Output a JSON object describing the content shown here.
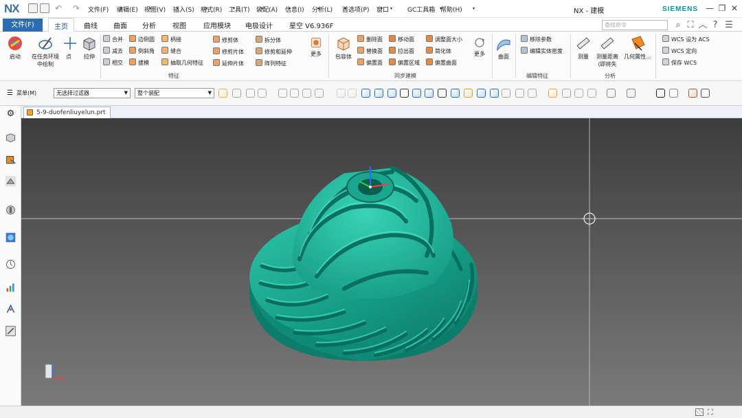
{
  "app": {
    "logo": "NX",
    "window_title": "NX - 建模",
    "brand": "SIEMENS"
  },
  "menubar": {
    "items": [
      "文件(F)",
      "编辑(E)",
      "视图(V)",
      "插入(S)",
      "格式(R)",
      "工具(T)",
      "装配(A)",
      "信息(I)",
      "分析(L)",
      "首选项(P)",
      "窗口",
      "GC工具箱",
      "帮助(H)"
    ]
  },
  "ribbon_tabs": {
    "file": "文件(F)",
    "tabs": [
      "主页",
      "曲线",
      "曲面",
      "分析",
      "视图",
      "应用模块",
      "电极设计",
      "星空 V6.936F"
    ],
    "active": "主页"
  },
  "search": {
    "placeholder": "查找命令"
  },
  "ribbon": {
    "sketch": {
      "label": "启动",
      "direct_sketch": "在任务环境中绘制",
      "point": "点",
      "extrude": "拉伸"
    },
    "feature": {
      "label": "特征",
      "col1": [
        "合并",
        "减去",
        "相交"
      ],
      "col2": [
        "边倒圆",
        "倒斜角",
        "拔模"
      ],
      "col3": [
        "柄接",
        "缝合",
        "抽取几何特征"
      ],
      "trim_col1": [
        "修剪体",
        "修剪片体",
        "延伸片体"
      ],
      "trim_col2": [
        "拆分体",
        "修剪和延伸",
        "阵列特征"
      ],
      "more": "更多"
    },
    "sync": {
      "label": "同步建模",
      "package": "包容体",
      "col1": [
        "删除面",
        "替换面",
        "偏置面"
      ],
      "col2": [
        "移动面",
        "拉出面",
        "偏置区域"
      ],
      "col3": [
        "调整面大小",
        "简化体",
        "偏置曲面"
      ],
      "more": "更多"
    },
    "surface": {
      "label": "曲面"
    },
    "edit_feature": {
      "label": "编辑特征",
      "items": [
        "移除参数",
        "编辑实体密度"
      ]
    },
    "analysis": {
      "label": "分析",
      "measure": "测量",
      "measure_distance": "测量距离(即将失",
      "geometry": "几何属性..."
    },
    "wcs": {
      "items": [
        "WCS 设为 ACS",
        "WCS 定向",
        "保存 WCS"
      ]
    }
  },
  "toolbar2": {
    "menu": "菜单(M)",
    "filter": "无选择过滤器",
    "scope": "整个装配"
  },
  "document": {
    "tab": "5-9-duofenliuyelun.prt"
  },
  "colors": {
    "model": "#1aa58f",
    "accent": "#2b6cb3"
  }
}
